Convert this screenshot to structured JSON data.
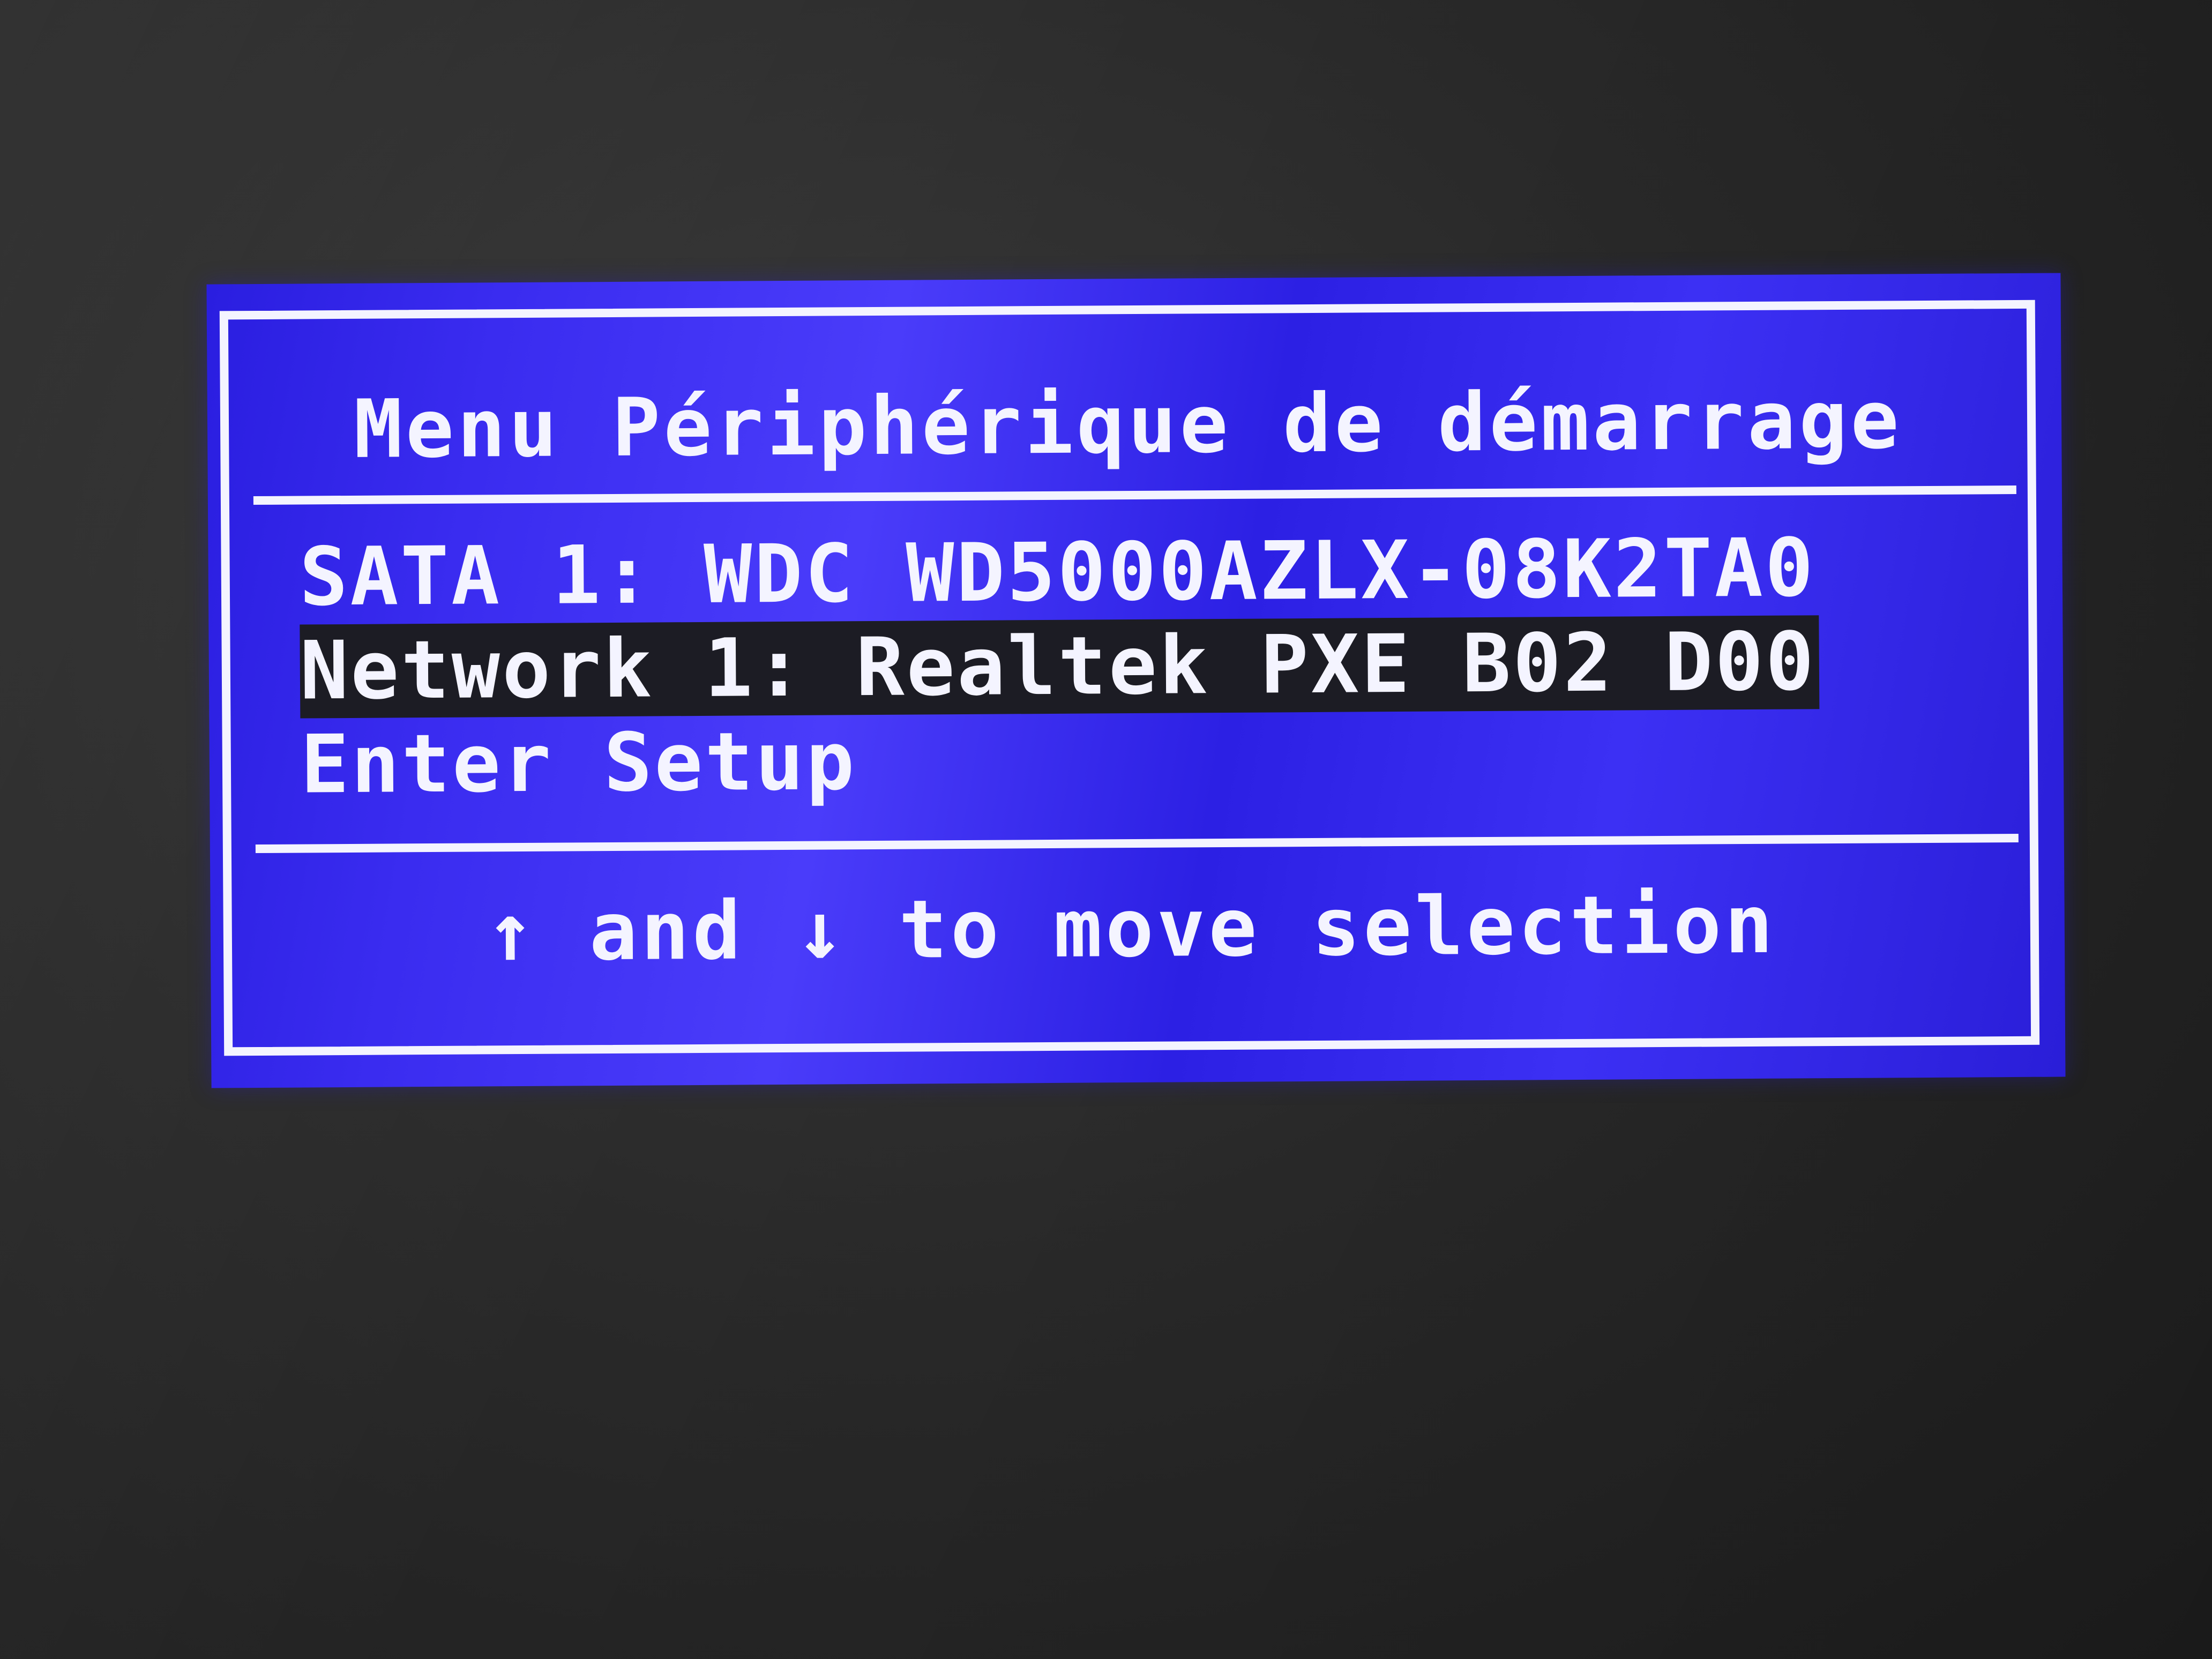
{
  "boot_menu": {
    "title": "Menu Périphérique de démarrage",
    "items": [
      {
        "label": "SATA 1: WDC WD5000AZLX-08K2TA0",
        "selected": false
      },
      {
        "label": "Network 1: Realtek PXE B02 D00",
        "selected": true
      },
      {
        "label": "Enter Setup",
        "selected": false
      }
    ],
    "hint": "↑ and ↓ to move selection"
  },
  "colors": {
    "panel_blue": "#3a2cf0",
    "text": "#f4f4ff",
    "selection_bg": "#1c1c24",
    "surround": "#2a2a2a"
  }
}
